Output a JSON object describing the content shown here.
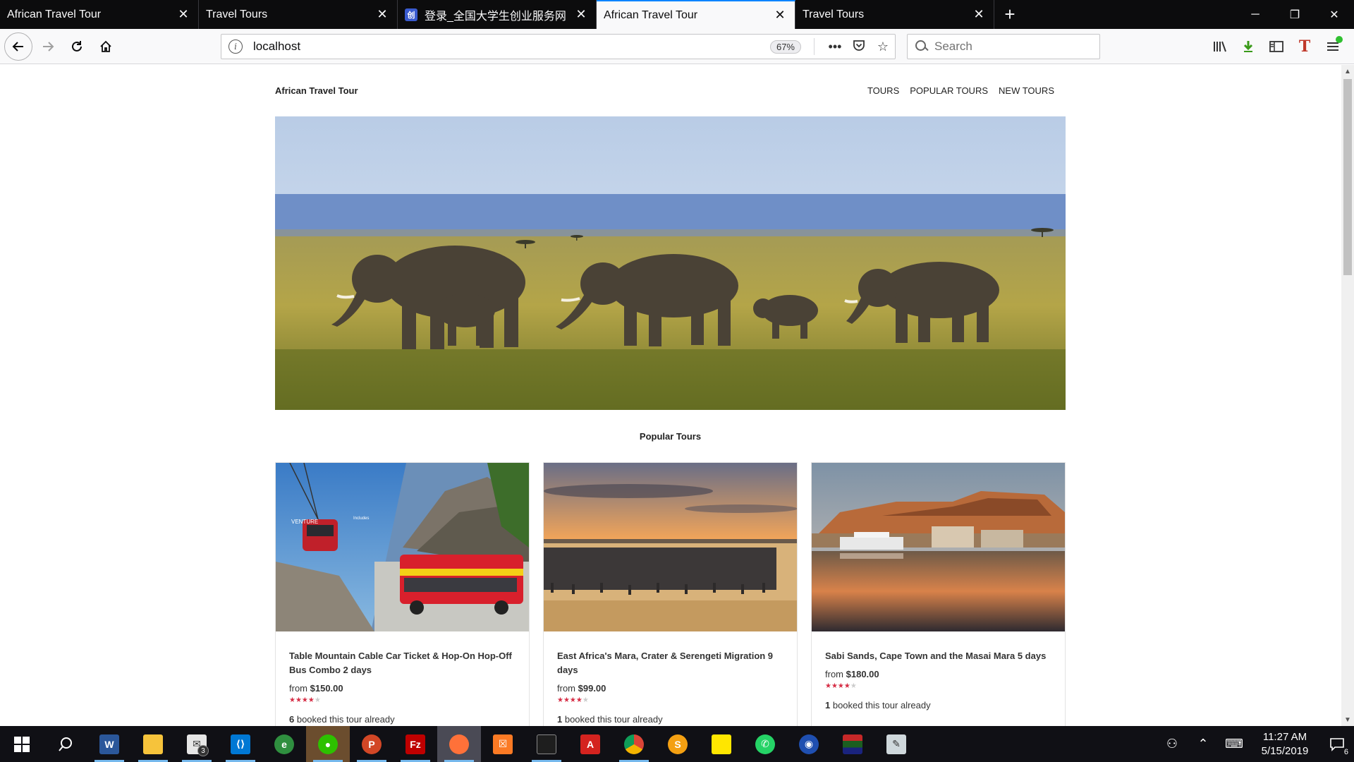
{
  "browser": {
    "tabs": [
      {
        "title": "African Travel Tour",
        "active": false,
        "favicon": ""
      },
      {
        "title": "Travel Tours",
        "active": false,
        "favicon": ""
      },
      {
        "title": "登录_全国大学生创业服务网",
        "active": false,
        "favicon": "创"
      },
      {
        "title": "African Travel Tour",
        "active": true,
        "favicon": ""
      },
      {
        "title": "Travel Tours",
        "active": false,
        "favicon": ""
      }
    ],
    "new_tab": "+",
    "url": "localhost",
    "zoom": "67%",
    "search_placeholder": "Search"
  },
  "site": {
    "brand": "African Travel Tour",
    "menu": [
      "TOURS",
      "POPULAR TOURS",
      "NEW TOURS"
    ],
    "section_title": "Popular Tours",
    "tours": [
      {
        "name": "Table Mountain Cable Car Ticket & Hop-On Hop-Off Bus Combo 2 days",
        "price_prefix": "from ",
        "price": "$150.00",
        "rating": 3.5,
        "booked_count": "6",
        "booked_text": " booked this tour already",
        "image": "cable-car-and-bus"
      },
      {
        "name": "East Africa's Mara, Crater & Serengeti Migration 9 days",
        "price_prefix": "from ",
        "price": "$99.00",
        "rating": 3.5,
        "booked_count": "1",
        "booked_text": " booked this tour already",
        "image": "wildebeest-sunset"
      },
      {
        "name": "Sabi Sands, Cape Town and the Masai Mara 5 days",
        "price_prefix": "from ",
        "price": "$180.00",
        "rating": 3.5,
        "booked_count": "1",
        "booked_text": " booked this tour already",
        "image": "cape-town-waterfront"
      }
    ],
    "hero_image": "elephants-savanna"
  },
  "taskbar": {
    "apps": [
      "start",
      "search",
      "word",
      "file-explorer",
      "mail",
      "vscode",
      "browser-maxthon",
      "wechat",
      "powerpoint",
      "filezilla",
      "firefox",
      "xampp",
      "terminal",
      "acrobat",
      "chrome",
      "sogou",
      "sticky-notes",
      "whatsapp",
      "app-blue",
      "app-flag",
      "paint"
    ],
    "mail_badge": "3",
    "time": "11:27 AM",
    "date": "5/15/2019",
    "notifications": "6"
  },
  "colors": {
    "accent": "#0a84ff",
    "star": "#d62d45",
    "taskbar": "#101015"
  }
}
